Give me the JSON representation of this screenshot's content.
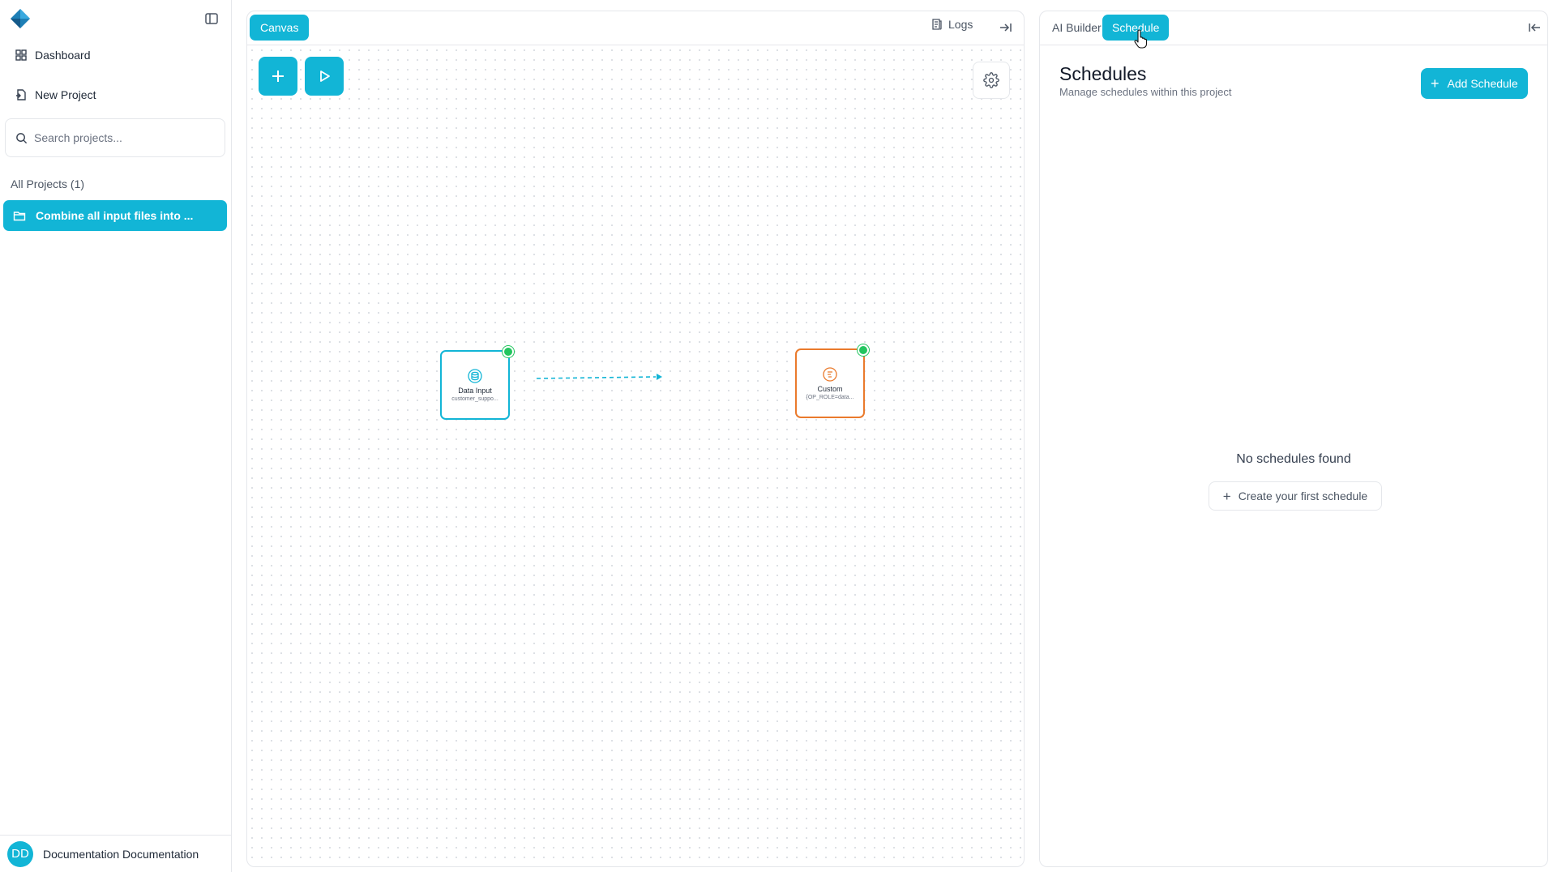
{
  "sidebar": {
    "nav": [
      {
        "label": "Dashboard",
        "icon": "dashboard-icon"
      },
      {
        "label": "New Project",
        "icon": "new-project-icon"
      }
    ],
    "search_placeholder": "Search projects...",
    "section_label": "All Projects (1)",
    "projects": [
      {
        "label": "Combine all input files into ...",
        "icon": "folder-icon",
        "active": true
      }
    ],
    "user": {
      "initials": "DD",
      "name": "Documentation Documentation"
    }
  },
  "canvas": {
    "tab_label": "Canvas",
    "logs_label": "Logs",
    "toolbar": {
      "add_icon": "plus-icon",
      "run_icon": "play-icon",
      "settings_icon": "gear-icon"
    },
    "nodes": [
      {
        "title": "Data Input",
        "subtitle": "customer_suppo...",
        "color": "#12b5d6",
        "icon": "database-icon",
        "status": "green"
      },
      {
        "title": "Custom",
        "subtitle": "{OP_ROLE=data...",
        "color": "#ea7a2c",
        "icon": "custom-icon",
        "status": "green"
      }
    ]
  },
  "right_panel": {
    "tabs": [
      {
        "label": "AI Builder",
        "active": false
      },
      {
        "label": "Schedule",
        "active": true
      }
    ],
    "title": "Schedules",
    "subtitle": "Manage schedules within this project",
    "add_button": "Add Schedule",
    "empty_text": "No schedules found",
    "create_first": "Create your first schedule"
  },
  "colors": {
    "accent": "#12b5d6",
    "custom_node": "#ea7a2c",
    "status_ok": "#22c55e"
  }
}
